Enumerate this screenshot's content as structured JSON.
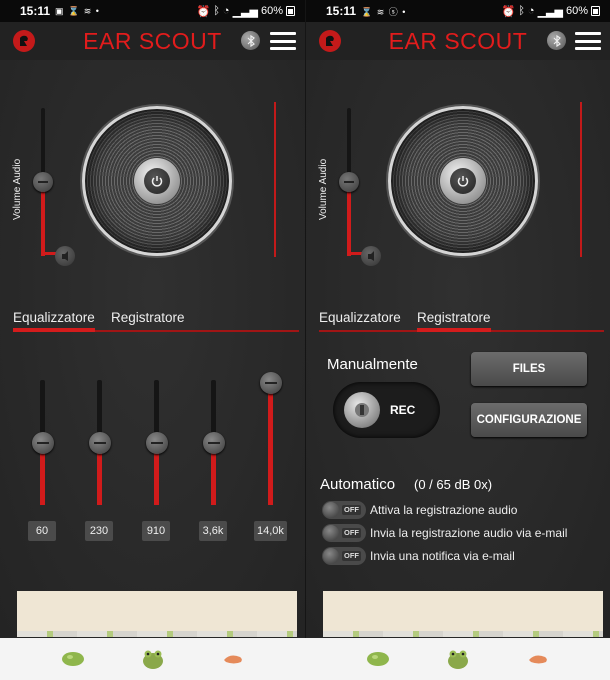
{
  "status_bar": {
    "left_time": "15:11",
    "right_time": "15:11",
    "battery": "60%"
  },
  "app": {
    "title": "EAR SCOUT",
    "brand_red": "#e21c1c"
  },
  "volume": {
    "label": "Volume Audio",
    "level": 0.5
  },
  "tabs": {
    "equalizer": "Equalizzatore",
    "recorder": "Registratore"
  },
  "equalizer": {
    "bands": [
      {
        "label": "60",
        "level": 0.4
      },
      {
        "label": "230",
        "level": 0.4
      },
      {
        "label": "910",
        "level": 0.4
      },
      {
        "label": "3,6k",
        "level": 0.4
      },
      {
        "label": "14,0k",
        "level": 0.9
      }
    ]
  },
  "recorder": {
    "manual_label": "Manualmente",
    "rec_label": "REC",
    "files_label": "FILES",
    "config_label": "CONFIGURAZIONE",
    "auto_label": "Automatico",
    "auto_status": "(0 / 65 dB 0x)",
    "options": [
      {
        "toggle": "OFF",
        "label": "Attiva la registrazione audio"
      },
      {
        "toggle": "OFF",
        "label": "Invia la registrazione audio via e-mail"
      },
      {
        "toggle": "OFF",
        "label": "Invia una notifica via e-mail"
      }
    ]
  },
  "icons": {
    "logo": "app-logo-icon",
    "bluetooth": "bluetooth-icon",
    "menu": "hamburger-menu-icon",
    "power": "power-icon",
    "mute": "mute-icon",
    "nav": [
      "bean-nav-icon",
      "frog-nav-icon",
      "shrimp-nav-icon"
    ]
  }
}
